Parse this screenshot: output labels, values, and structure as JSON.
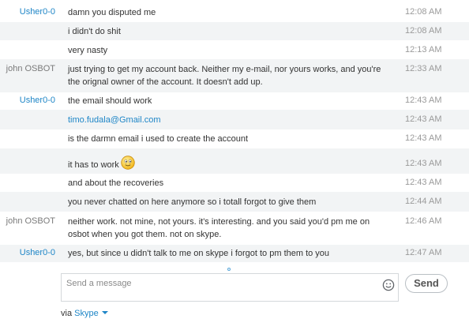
{
  "messages": [
    {
      "sender": "Usher0-0",
      "sender_color": "#1f86c7",
      "text": "damn you disputed me",
      "time": "12:08 AM"
    },
    {
      "sender": "",
      "text": "i didn't do shit",
      "time": "12:08 AM"
    },
    {
      "sender": "",
      "text": "very nasty",
      "time": "12:13 AM"
    },
    {
      "sender": "john OSBOT",
      "sender_color": "#7a7a7a",
      "text": "just trying to get my account back. Neither my e-mail, nor yours works, and you're the orignal owner of the account. It doesn't add up.",
      "time": "12:33 AM"
    },
    {
      "sender": "Usher0-0",
      "sender_color": "#1f86c7",
      "text": "the email should work",
      "time": "12:43 AM"
    },
    {
      "sender": "",
      "text": "timo.fudala@Gmail.com",
      "is_link": true,
      "time": "12:43 AM"
    },
    {
      "sender": "",
      "text": "is the darmn email i used to create the account",
      "time": "12:43 AM"
    },
    {
      "sender": "",
      "text": "it has to work",
      "emoticon": "smiley-icon",
      "time": "12:43 AM"
    },
    {
      "sender": "",
      "text": "and about the recoveries",
      "time": "12:43 AM"
    },
    {
      "sender": "",
      "text": "you never chatted on here anymore so i totall forgot to give them",
      "time": "12:44 AM"
    },
    {
      "sender": "john OSBOT",
      "sender_color": "#7a7a7a",
      "text": "neither work. not mine, not yours. it's interesting. and you said you'd pm me on osbot when you got them. not on skype.",
      "time": "12:46 AM"
    },
    {
      "sender": "Usher0-0",
      "sender_color": "#1f86c7",
      "text": "yes, but since u didn't talk to me on skype i forgot to pm them to you",
      "time": "12:47 AM"
    }
  ],
  "composer": {
    "placeholder": "Send a message",
    "value": "",
    "emoji_icon": "emoticon-icon",
    "send_label": "Send"
  },
  "footer": {
    "via_label": "via",
    "network": "Skype",
    "dropdown_icon": "caret-down-icon"
  },
  "colors": {
    "accent": "#1f86c7",
    "alt_row": "#f2f4f5",
    "timestamp": "#9a9a9a"
  }
}
